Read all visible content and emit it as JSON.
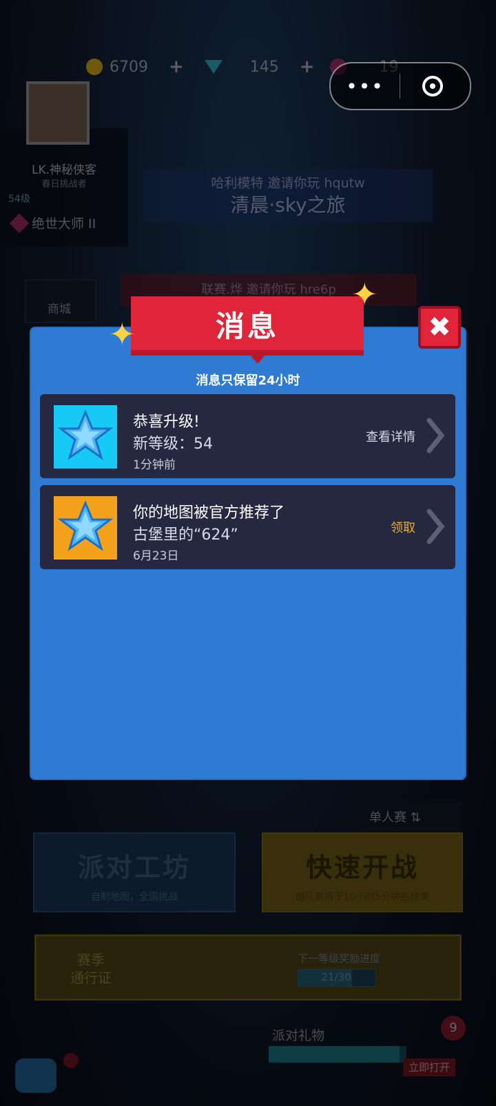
{
  "colors": {
    "dialog_bg": "#2f7ad2",
    "banner_red": "#e0243a",
    "card_bg": "#262740",
    "icon_cyan": "#17c9f5",
    "icon_orange": "#f4a21c",
    "claim_gold": "#e8b21a"
  },
  "topbar": {
    "coins": "6709",
    "gems": "145",
    "tickets": "19",
    "coin_icon": "coin-icon",
    "gem_icon": "gem-icon",
    "ticket_icon": "ticket-icon"
  },
  "capsule": {
    "more_icon": "more-dots-icon",
    "close_icon": "target-icon"
  },
  "profile": {
    "name": "LK.神秘侠客",
    "subtitle": "春日挑战者",
    "level": "54级",
    "rank": "绝世大师 II"
  },
  "shop": {
    "label": "商城"
  },
  "invites": [
    {
      "line1": "哈利模特 邀请你玩 hqutw",
      "line2": "清晨·sky之旅"
    },
    {
      "line1": "联赛.烨 邀请你玩 hre6p"
    }
  ],
  "dialog": {
    "title": "消息",
    "notice": "消息只保留24小时",
    "close_icon": "close-x-icon",
    "messages": [
      {
        "title": "恭喜升级!",
        "detail": "新等级：54",
        "time": "1分钟前",
        "action": "查看详情",
        "action_color": "#d6d8e4",
        "icon": "star-crystal-icon",
        "icon_bg": "#17c9f5"
      },
      {
        "title": "你的地图被官方推荐了",
        "detail": "古堡里的“624”",
        "time": "6月23日",
        "action": "领取",
        "action_color": "#e8b21a",
        "icon": "star-crystal-icon",
        "icon_bg": "#f4a21c"
      }
    ]
  },
  "bottom": {
    "mode": "单人赛",
    "party": {
      "title": "派对工坊",
      "subtitle": "自制地图，全国挑战"
    },
    "quick": {
      "title": "快速开战",
      "subtitle": "组队赛将于10小时5分钟后结束"
    },
    "season": {
      "label": "赛季\n通行证",
      "progress_label": "下一等级奖励进度",
      "progress_text": "21/30",
      "progress": 0.7
    },
    "gift": {
      "label": "派对礼物",
      "count": "9",
      "open": "立即打开",
      "progress": 0.95
    }
  }
}
